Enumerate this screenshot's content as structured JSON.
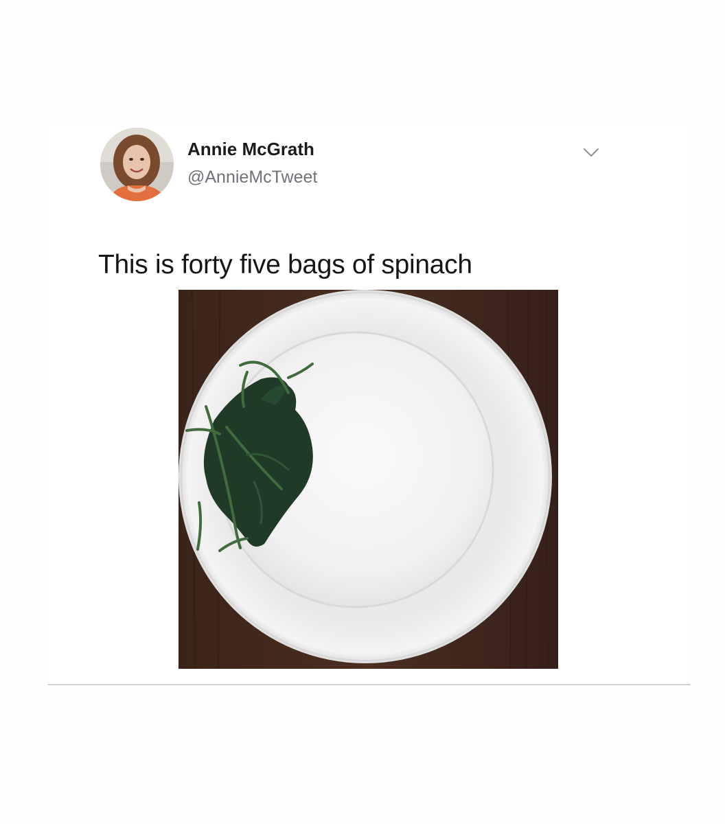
{
  "tweet": {
    "display_name": "Annie McGrath",
    "handle": "@AnnieMcTweet",
    "text": "This is forty five bags of spinach",
    "menu_icon": "chevron-down-icon",
    "avatar_icon": "profile-photo",
    "media_icon": "photo-plate-spinach"
  },
  "colors": {
    "name_text": "#1b1b1b",
    "handle_text": "#6f7378",
    "body_text": "#161616",
    "caret": "#8a9097",
    "divider": "#d2d2d2",
    "table_wood": "#3d261a",
    "plate": "#f2f2f2",
    "spinach": "#1f3a27"
  }
}
